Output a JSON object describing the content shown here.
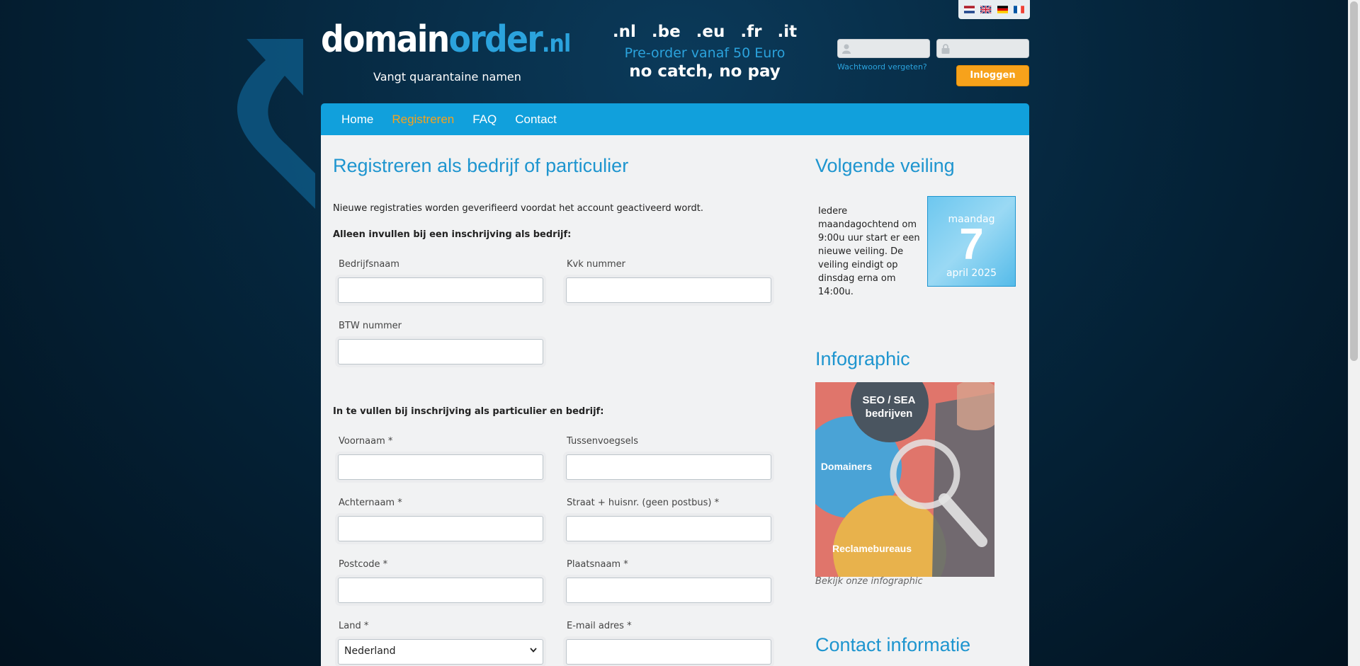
{
  "flags": [
    "nl-flag-icon",
    "gb-flag-icon",
    "de-flag-icon",
    "fr-flag-icon"
  ],
  "header": {
    "logo": {
      "domain": "domain",
      "order": "order",
      "nl": ".nl"
    },
    "tagline": "Vangt quarantaine namen",
    "promo": {
      "tlds": ".nl .be .eu .fr .it",
      "preorder": "Pre-order vanaf 50 Euro",
      "catch": "no catch, no pay"
    },
    "login": {
      "username_placeholder": "",
      "password_placeholder": "",
      "forgot": "Wachtwoord vergeten?",
      "button": "Inloggen"
    }
  },
  "nav": {
    "items": [
      {
        "label": "Home"
      },
      {
        "label": "Registreren"
      },
      {
        "label": "FAQ"
      },
      {
        "label": "Contact"
      }
    ],
    "active": "Registreren"
  },
  "main": {
    "title": "Registreren als bedrijf of particulier",
    "intro": "Nieuwe registraties worden geverifieerd voordat het account geactiveerd wordt.",
    "business_section": "Alleen invullen bij een inschrijving als bedrijf:",
    "business_fields": {
      "company": "Bedrijfsnaam",
      "kvk": "Kvk nummer",
      "vat": "BTW nummer"
    },
    "personal_section": "In te vullen bij inschrijving als particulier en bedrijf:",
    "personal_fields": {
      "firstname": "Voornaam *",
      "infix": "Tussenvoegsels",
      "lastname": "Achternaam *",
      "street": "Straat + huisnr. (geen postbus) *",
      "postcode": "Postcode *",
      "city": "Plaatsnaam *",
      "country": "Land *",
      "email": "E-mail adres *"
    },
    "country_value": "Nederland"
  },
  "sidebar": {
    "auction_title": "Volgende veiling",
    "auction_text": "Iedere maandagochtend om 9:00u uur start er een nieuwe veiling. De veiling eindigt op dinsdag erna om 14:00u.",
    "date": {
      "day": "maandag",
      "num": "7",
      "month": "april 2025"
    },
    "infographic_title": "Infographic",
    "infographic": {
      "seo": "SEO / SEA",
      "seo2": "bedrijven",
      "domainers": "Domainers",
      "reclame": "Reclamebureaus"
    },
    "infographic_caption": "Bekijk onze infographic",
    "contact_title": "Contact informatie"
  },
  "colors": {
    "accent": "#11a0dc",
    "orange": "#f7a21b",
    "heading": "#1e95cf"
  }
}
